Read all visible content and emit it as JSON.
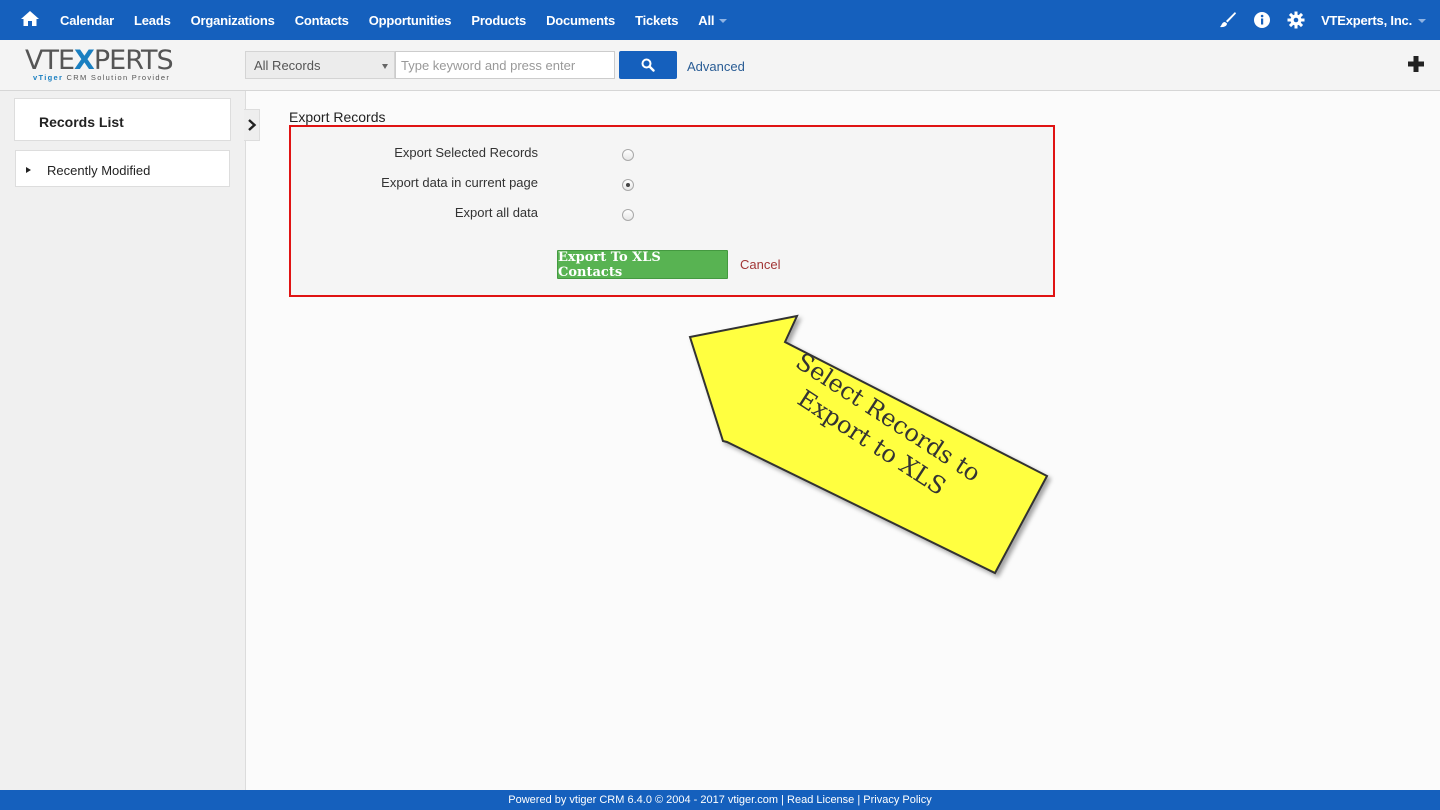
{
  "topnav": {
    "items": [
      "Calendar",
      "Leads",
      "Organizations",
      "Contacts",
      "Opportunities",
      "Products",
      "Documents",
      "Tickets",
      "All"
    ],
    "user": "VTExperts, Inc."
  },
  "logo": {
    "word_a": "VTE",
    "word_x": "X",
    "word_b": "PERTS",
    "tag_a": "vTiger",
    "tag_b": " CRM Solution Provider"
  },
  "search": {
    "scope": "All Records",
    "placeholder": "Type keyword and press enter",
    "advanced": "Advanced"
  },
  "sidebar": {
    "title": "Records List",
    "items": [
      "Recently Modified"
    ]
  },
  "export": {
    "title": "Export Records",
    "options": [
      {
        "label": "Export Selected Records",
        "checked": false
      },
      {
        "label": "Export data in current page",
        "checked": true
      },
      {
        "label": "Export all data",
        "checked": false
      }
    ],
    "export_button": "Export To XLS Contacts",
    "cancel": "Cancel"
  },
  "callout": {
    "line1": "Select Records to",
    "line2": "Export to XLS",
    "color": "#ffff40"
  },
  "footer": {
    "text": "Powered by vtiger CRM 6.4.0  © 2004 - 2017  vtiger.com | Read License | Privacy Policy"
  },
  "colors": {
    "brand": "#1560bd",
    "success": "#58b352",
    "highlight": "#e01313"
  }
}
